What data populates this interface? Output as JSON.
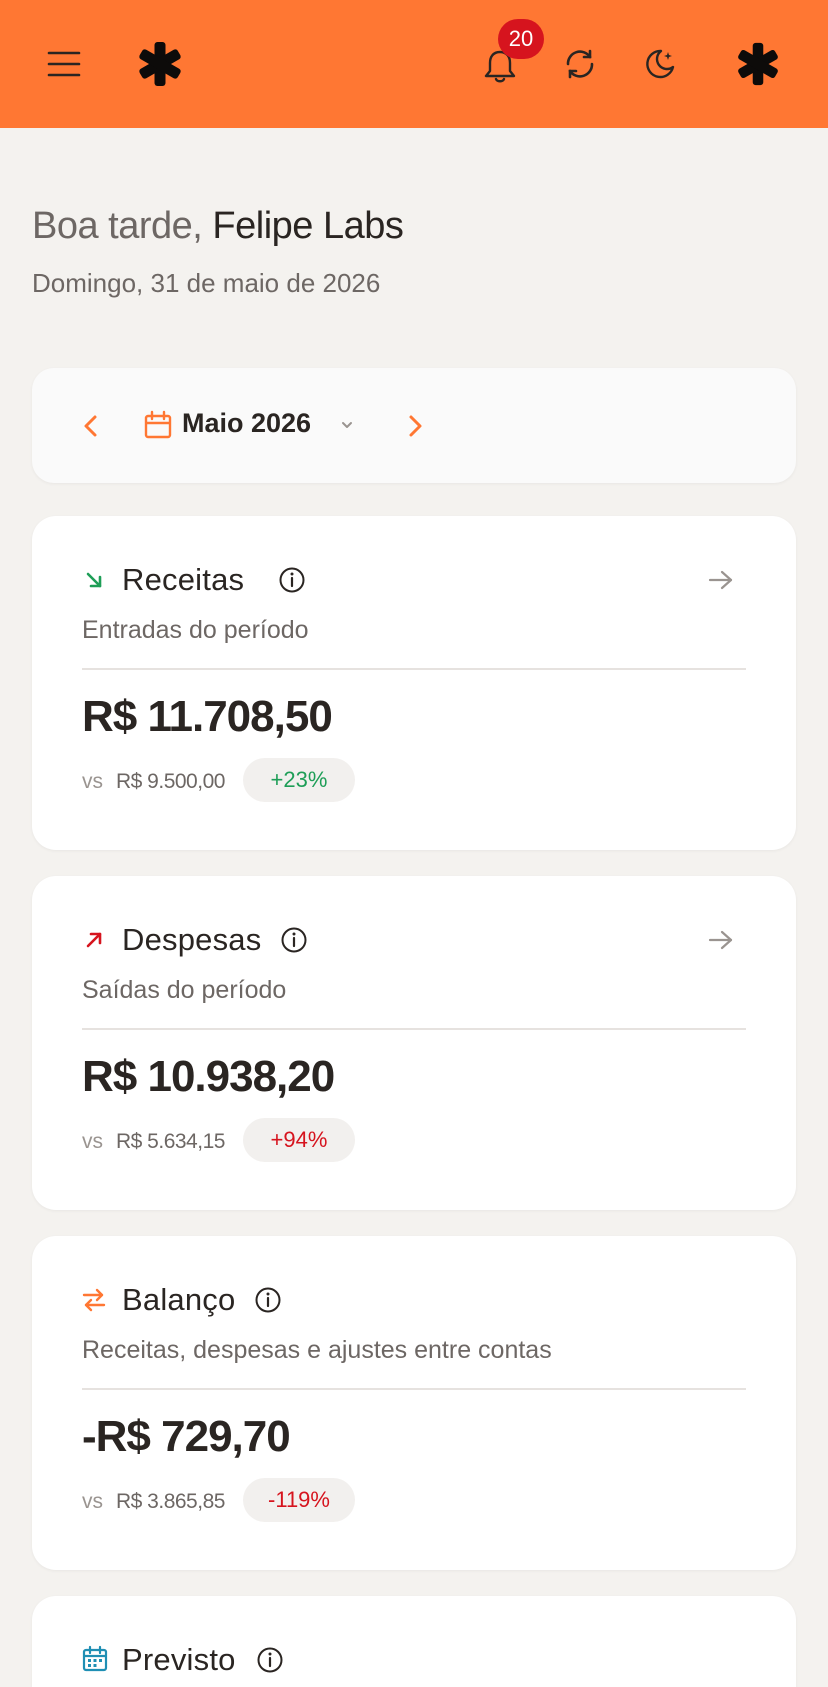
{
  "header": {
    "notification_count": "20",
    "icons": [
      "menu-icon",
      "asterisk-logo-icon",
      "bell-icon",
      "sync-icon",
      "moon-icon",
      "asterisk-avatar-icon"
    ],
    "background_color": "#ff7733"
  },
  "greeting": {
    "prefix": "Boa tarde,",
    "name": "Felipe Labs",
    "date": "Domingo, 31 de maio de 2026"
  },
  "month_selector": {
    "label": "Maio 2026"
  },
  "cards": [
    {
      "title": "Receitas",
      "subtitle": "Entradas do período",
      "amount": "R$ 11.708,50",
      "vs": "vs",
      "previous": "R$ 9.500,00",
      "change": "+23%",
      "trend": "up"
    },
    {
      "title": "Despesas",
      "subtitle": "Saídas do período",
      "amount": "R$ 10.938,20",
      "vs": "vs",
      "previous": "R$ 5.634,15",
      "change": "+94%",
      "trend": "down"
    },
    {
      "title": "Balanço",
      "subtitle": "Receitas, despesas e ajustes entre contas",
      "amount": "-R$ 729,70",
      "vs": "vs",
      "previous": "R$ 3.865,85",
      "change": "-119%",
      "trend": "down"
    },
    {
      "title": "Previsto"
    }
  ],
  "colors": {
    "accent": "#ff7733",
    "positive": "#1e9e57",
    "negative": "#d6141e",
    "info": "#1f8fb4"
  }
}
